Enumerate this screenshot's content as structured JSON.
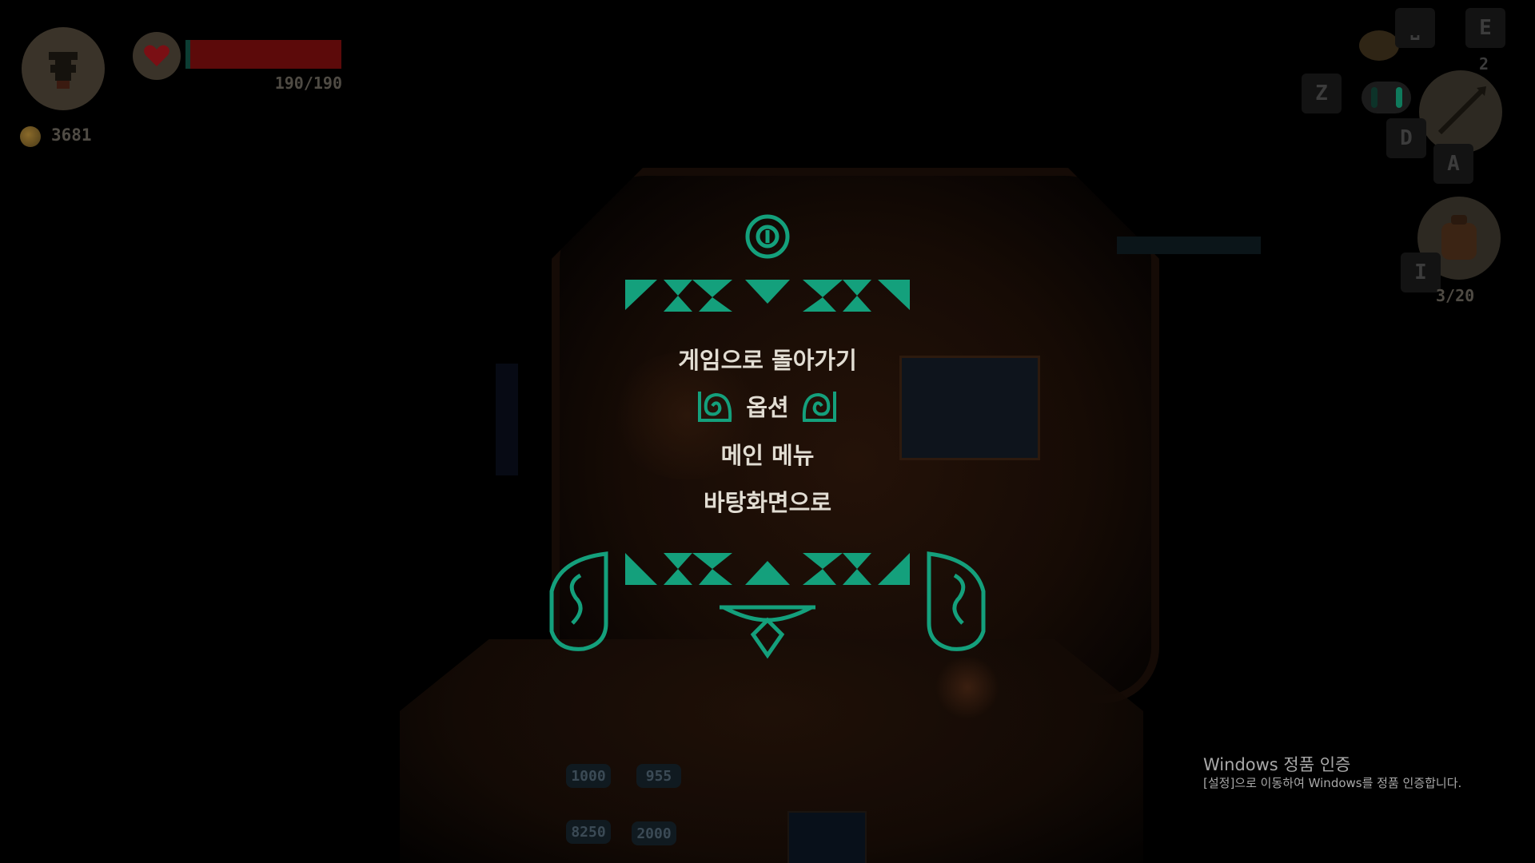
{
  "hud": {
    "hp_text": "190/190",
    "hp_fraction": 1.0,
    "coins": "3681",
    "keys": {
      "space": "⎵",
      "e": "E",
      "z": "Z",
      "d": "D",
      "a": "A",
      "i": "I"
    },
    "e_count": "2",
    "inventory_count": "3/20",
    "icons": [
      "character-portrait-icon",
      "heart-icon",
      "coin-icon",
      "weapon-spear-icon",
      "bag-icon",
      "pet-icon"
    ]
  },
  "pause_menu": {
    "items": [
      {
        "label": "게임으로 돌아가기"
      },
      {
        "label": "옵션",
        "selected": true
      },
      {
        "label": "메인 메뉴"
      },
      {
        "label": "바탕화면으로"
      }
    ],
    "frame_color": "#14a07c",
    "text_color": "#e2ddd3"
  },
  "scene": {
    "price_tags": [
      "1000",
      "955",
      "8250",
      "2000"
    ]
  },
  "watermark": {
    "title": "Windows 정품 인증",
    "subtitle": "[설정]으로 이동하여 Windows를 정품 인증합니다."
  }
}
